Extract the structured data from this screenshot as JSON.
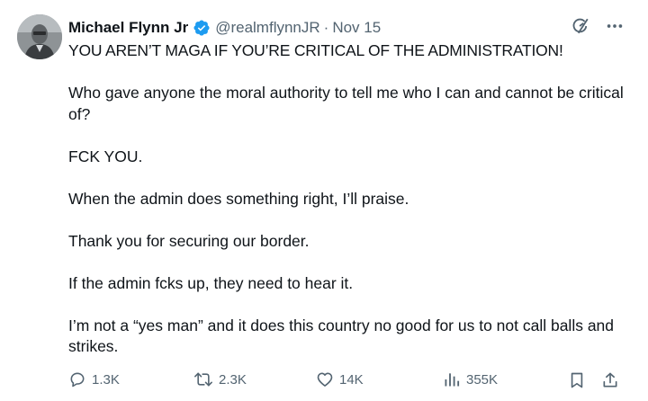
{
  "author": {
    "name": "Michael Flynn Jr",
    "handle": "@realmflynnJR",
    "separator": "·",
    "date": "Nov 15"
  },
  "tweet": {
    "paragraphs": [
      "YOU AREN’T MAGA IF YOU’RE CRITICAL OF THE ADMINISTRATION!",
      "Who gave anyone the moral authority to tell me who I can and cannot be critical of?",
      "FCK YOU.",
      "When the admin does something right, I’ll praise.",
      "Thank you for securing our border.",
      "If the admin fcks up, they need to hear it.",
      "I’m not a “yes man” and it does this country no good for us to not call balls and strikes."
    ]
  },
  "metrics": {
    "replies": "1.3K",
    "retweets": "2.3K",
    "likes": "14K",
    "views": "355K"
  },
  "icons": {
    "verified": "verified-badge-icon",
    "grok": "grok-icon",
    "more": "more-icon",
    "reply": "reply-icon",
    "retweet": "retweet-icon",
    "like": "heart-icon",
    "views": "views-icon",
    "bookmark": "bookmark-icon",
    "share": "share-icon"
  },
  "colors": {
    "verified_blue": "#1d9bf0",
    "text": "#0f1419",
    "secondary": "#536471"
  }
}
